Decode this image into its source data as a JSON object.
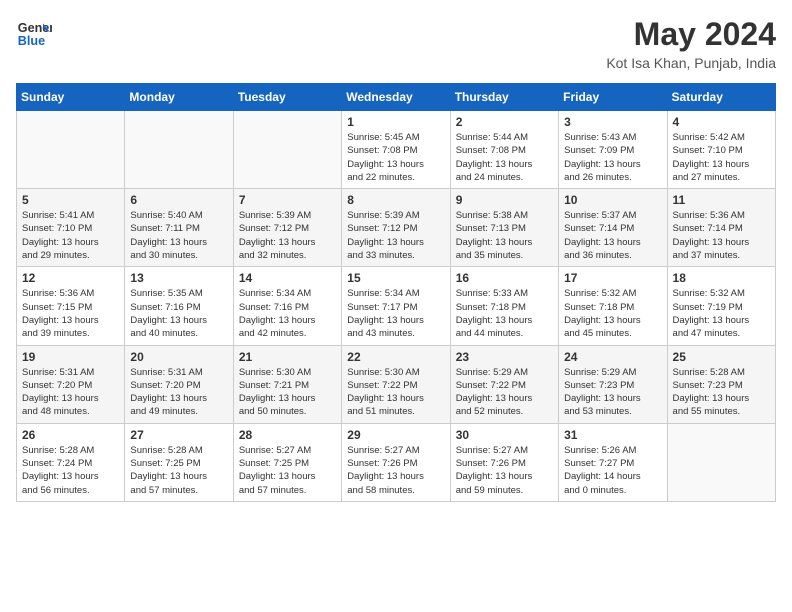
{
  "logo": {
    "line1": "General",
    "line2": "Blue"
  },
  "title": "May 2024",
  "location": "Kot Isa Khan, Punjab, India",
  "weekdays": [
    "Sunday",
    "Monday",
    "Tuesday",
    "Wednesday",
    "Thursday",
    "Friday",
    "Saturday"
  ],
  "weeks": [
    [
      {
        "day": "",
        "info": ""
      },
      {
        "day": "",
        "info": ""
      },
      {
        "day": "",
        "info": ""
      },
      {
        "day": "1",
        "info": "Sunrise: 5:45 AM\nSunset: 7:08 PM\nDaylight: 13 hours\nand 22 minutes."
      },
      {
        "day": "2",
        "info": "Sunrise: 5:44 AM\nSunset: 7:08 PM\nDaylight: 13 hours\nand 24 minutes."
      },
      {
        "day": "3",
        "info": "Sunrise: 5:43 AM\nSunset: 7:09 PM\nDaylight: 13 hours\nand 26 minutes."
      },
      {
        "day": "4",
        "info": "Sunrise: 5:42 AM\nSunset: 7:10 PM\nDaylight: 13 hours\nand 27 minutes."
      }
    ],
    [
      {
        "day": "5",
        "info": "Sunrise: 5:41 AM\nSunset: 7:10 PM\nDaylight: 13 hours\nand 29 minutes."
      },
      {
        "day": "6",
        "info": "Sunrise: 5:40 AM\nSunset: 7:11 PM\nDaylight: 13 hours\nand 30 minutes."
      },
      {
        "day": "7",
        "info": "Sunrise: 5:39 AM\nSunset: 7:12 PM\nDaylight: 13 hours\nand 32 minutes."
      },
      {
        "day": "8",
        "info": "Sunrise: 5:39 AM\nSunset: 7:12 PM\nDaylight: 13 hours\nand 33 minutes."
      },
      {
        "day": "9",
        "info": "Sunrise: 5:38 AM\nSunset: 7:13 PM\nDaylight: 13 hours\nand 35 minutes."
      },
      {
        "day": "10",
        "info": "Sunrise: 5:37 AM\nSunset: 7:14 PM\nDaylight: 13 hours\nand 36 minutes."
      },
      {
        "day": "11",
        "info": "Sunrise: 5:36 AM\nSunset: 7:14 PM\nDaylight: 13 hours\nand 37 minutes."
      }
    ],
    [
      {
        "day": "12",
        "info": "Sunrise: 5:36 AM\nSunset: 7:15 PM\nDaylight: 13 hours\nand 39 minutes."
      },
      {
        "day": "13",
        "info": "Sunrise: 5:35 AM\nSunset: 7:16 PM\nDaylight: 13 hours\nand 40 minutes."
      },
      {
        "day": "14",
        "info": "Sunrise: 5:34 AM\nSunset: 7:16 PM\nDaylight: 13 hours\nand 42 minutes."
      },
      {
        "day": "15",
        "info": "Sunrise: 5:34 AM\nSunset: 7:17 PM\nDaylight: 13 hours\nand 43 minutes."
      },
      {
        "day": "16",
        "info": "Sunrise: 5:33 AM\nSunset: 7:18 PM\nDaylight: 13 hours\nand 44 minutes."
      },
      {
        "day": "17",
        "info": "Sunrise: 5:32 AM\nSunset: 7:18 PM\nDaylight: 13 hours\nand 45 minutes."
      },
      {
        "day": "18",
        "info": "Sunrise: 5:32 AM\nSunset: 7:19 PM\nDaylight: 13 hours\nand 47 minutes."
      }
    ],
    [
      {
        "day": "19",
        "info": "Sunrise: 5:31 AM\nSunset: 7:20 PM\nDaylight: 13 hours\nand 48 minutes."
      },
      {
        "day": "20",
        "info": "Sunrise: 5:31 AM\nSunset: 7:20 PM\nDaylight: 13 hours\nand 49 minutes."
      },
      {
        "day": "21",
        "info": "Sunrise: 5:30 AM\nSunset: 7:21 PM\nDaylight: 13 hours\nand 50 minutes."
      },
      {
        "day": "22",
        "info": "Sunrise: 5:30 AM\nSunset: 7:22 PM\nDaylight: 13 hours\nand 51 minutes."
      },
      {
        "day": "23",
        "info": "Sunrise: 5:29 AM\nSunset: 7:22 PM\nDaylight: 13 hours\nand 52 minutes."
      },
      {
        "day": "24",
        "info": "Sunrise: 5:29 AM\nSunset: 7:23 PM\nDaylight: 13 hours\nand 53 minutes."
      },
      {
        "day": "25",
        "info": "Sunrise: 5:28 AM\nSunset: 7:23 PM\nDaylight: 13 hours\nand 55 minutes."
      }
    ],
    [
      {
        "day": "26",
        "info": "Sunrise: 5:28 AM\nSunset: 7:24 PM\nDaylight: 13 hours\nand 56 minutes."
      },
      {
        "day": "27",
        "info": "Sunrise: 5:28 AM\nSunset: 7:25 PM\nDaylight: 13 hours\nand 57 minutes."
      },
      {
        "day": "28",
        "info": "Sunrise: 5:27 AM\nSunset: 7:25 PM\nDaylight: 13 hours\nand 57 minutes."
      },
      {
        "day": "29",
        "info": "Sunrise: 5:27 AM\nSunset: 7:26 PM\nDaylight: 13 hours\nand 58 minutes."
      },
      {
        "day": "30",
        "info": "Sunrise: 5:27 AM\nSunset: 7:26 PM\nDaylight: 13 hours\nand 59 minutes."
      },
      {
        "day": "31",
        "info": "Sunrise: 5:26 AM\nSunset: 7:27 PM\nDaylight: 14 hours\nand 0 minutes."
      },
      {
        "day": "",
        "info": ""
      }
    ]
  ]
}
